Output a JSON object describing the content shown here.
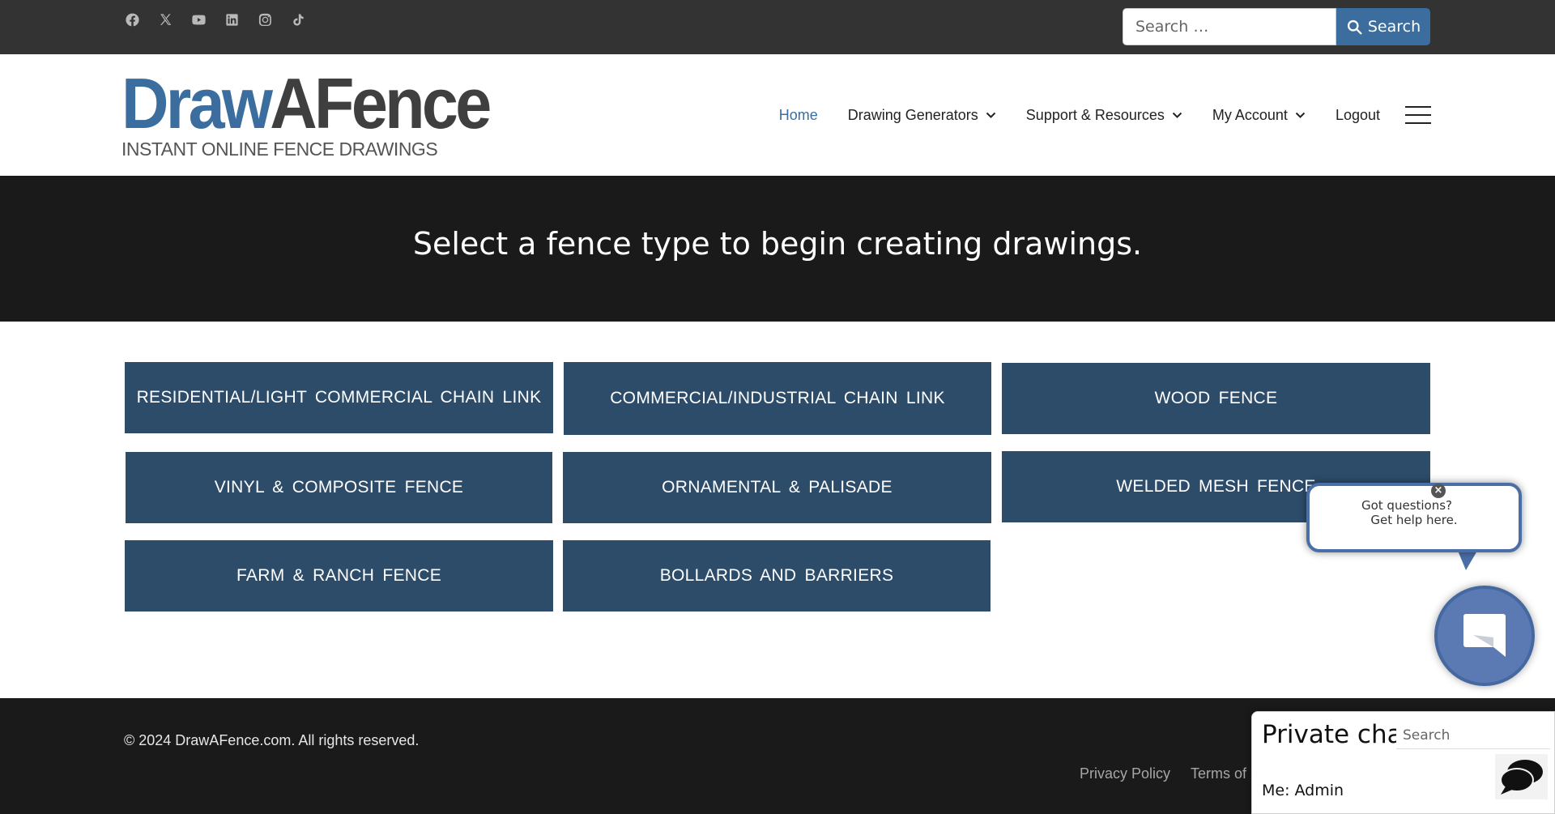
{
  "topbar": {
    "social": [
      {
        "name": "facebook-icon"
      },
      {
        "name": "x-twitter-icon"
      },
      {
        "name": "youtube-icon"
      },
      {
        "name": "linkedin-icon"
      },
      {
        "name": "instagram-icon"
      },
      {
        "name": "tiktok-icon"
      }
    ],
    "search": {
      "placeholder": "Search …",
      "button_label": "Search"
    }
  },
  "header": {
    "logo": {
      "part1": "Draw",
      "part2": "AFence",
      "tagline": "INSTANT ONLINE FENCE DRAWINGS"
    },
    "nav": [
      {
        "label": "Home",
        "active": true,
        "dropdown": false
      },
      {
        "label": "Drawing Generators",
        "active": false,
        "dropdown": true
      },
      {
        "label": "Support & Resources",
        "active": false,
        "dropdown": true
      },
      {
        "label": "My Account",
        "active": false,
        "dropdown": true
      },
      {
        "label": "Logout",
        "active": false,
        "dropdown": false
      }
    ]
  },
  "hero": {
    "title": "Select a fence type to begin creating drawings."
  },
  "fence_types": [
    "RESIDENTIAL/LIGHT COMMERCIAL CHAIN LINK",
    "COMMERCIAL/INDUSTRIAL CHAIN LINK",
    "WOOD FENCE",
    "VINYL & COMPOSITE FENCE",
    "ORNAMENTAL & PALISADE",
    "WELDED MESH FENCE",
    "FARM & RANCH FENCE",
    "BOLLARDS AND BARRIERS"
  ],
  "chat_prompt": {
    "line1": "Got questions?",
    "line2": "Get help here.",
    "close": "×"
  },
  "footer": {
    "copyright": "© 2024 DrawAFence.com. All rights reserved.",
    "links": [
      "Privacy Policy",
      "Terms of Se"
    ]
  },
  "private_chat": {
    "title": "Private chat",
    "search_placeholder": "Search",
    "me_label": "Me: Admin"
  },
  "colors": {
    "accent": "#3b6e9e",
    "button": "#2d4c6a",
    "topbar": "#333333",
    "dark": "#1a1a1a",
    "chat": "#5b7ab4"
  }
}
